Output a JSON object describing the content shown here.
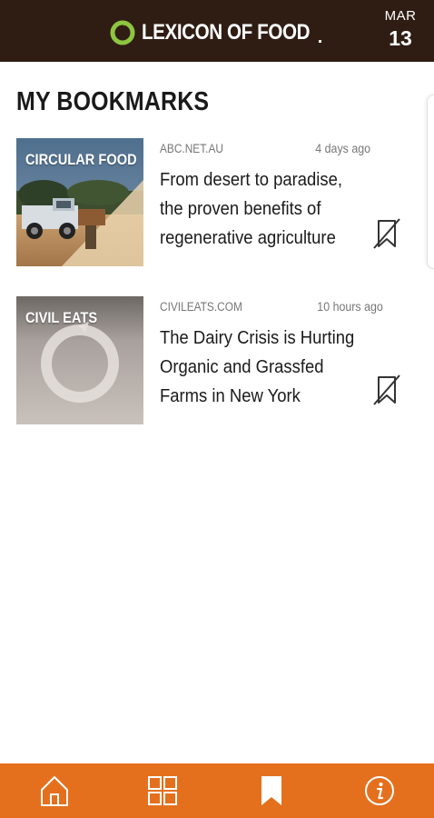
{
  "header": {
    "logo_text": "LEXICON OF FOOD",
    "date_month": "MAR",
    "date_day": "13"
  },
  "page": {
    "title": "MY BOOKMARKS"
  },
  "bookmarks": [
    {
      "thumb_label": "CIRCULAR FOOD",
      "source": "ABC.NET.AU",
      "time": "4 days ago",
      "title": "From desert to paradise, the proven benefits of regenerative agriculture"
    },
    {
      "thumb_label": "CIVIL EATS",
      "source": "CIVILEATS.COM",
      "time": "10 hours ago",
      "title": "The Dairy Crisis is Hurting Organic and Grassfed Farms in New York"
    }
  ],
  "nav": {
    "items": [
      {
        "icon": "home-icon"
      },
      {
        "icon": "grid-icon"
      },
      {
        "icon": "bookmark-icon"
      },
      {
        "icon": "info-icon"
      }
    ]
  },
  "colors": {
    "header_bg": "#2f1d14",
    "logo_green": "#8dc63f",
    "nav_bg": "#e4701e"
  }
}
